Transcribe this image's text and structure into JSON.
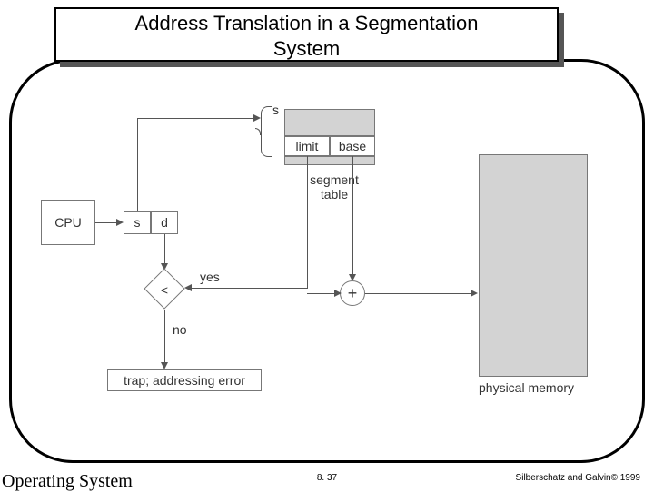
{
  "title": {
    "line1": "Address Translation in a Segmentation",
    "line2": "System"
  },
  "diagram": {
    "cpu": "CPU",
    "s": "s",
    "d": "d",
    "segTable": {
      "limit": "limit",
      "base": "base",
      "caption": "segment\ntable"
    },
    "braceLabel": "s",
    "compare": "<",
    "yes": "yes",
    "no": "no",
    "adder": "+",
    "trap": "trap; addressing error",
    "physmem": "physical memory"
  },
  "footer": {
    "left": "Operating System",
    "center": "8. 37",
    "right": "Silberschatz and Galvin© 1999"
  }
}
